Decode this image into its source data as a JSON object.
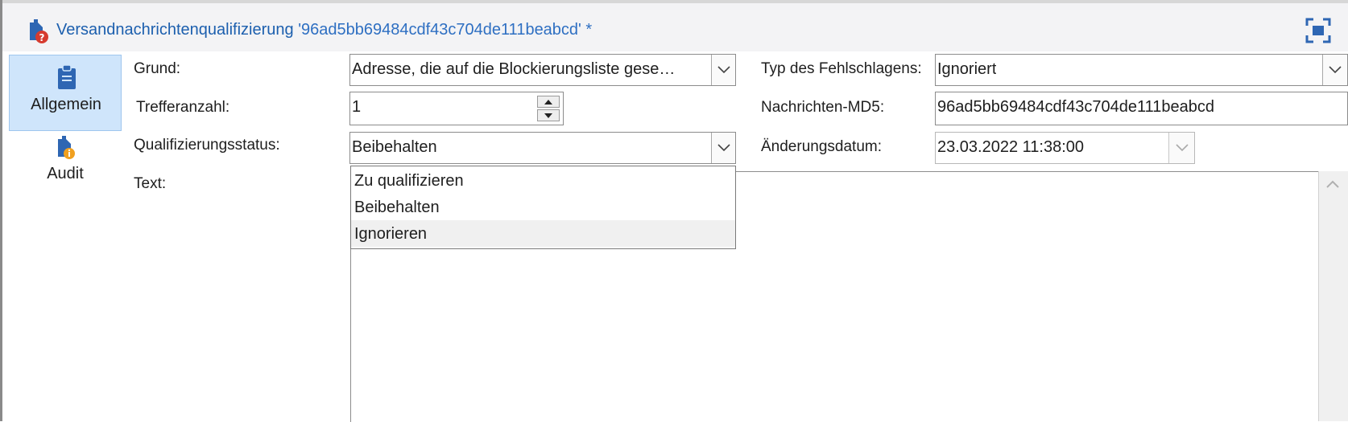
{
  "window": {
    "title_prefix": "Versandnachrichtenqualifizierung ",
    "title_id": "'96ad5bb69484cdf43c704de111beabcd' *",
    "maximize_icon": "maximize-icon"
  },
  "tabs": [
    {
      "label": "Allgemein",
      "icon": "clipboard-icon",
      "active": true
    },
    {
      "label": "Audit",
      "icon": "audit-info-icon",
      "active": false
    }
  ],
  "form": {
    "grund": {
      "label": "Grund:",
      "value": "Adresse, die auf die Blockierungsliste gese…"
    },
    "trefferanzahl": {
      "label": "Trefferanzahl:",
      "value": "1"
    },
    "qualifizierungsstatus": {
      "label": "Qualifizierungsstatus:",
      "value": "Beibehalten"
    },
    "text": {
      "label": "Text:"
    },
    "typ": {
      "label": "Typ des Fehlschlagens:",
      "value": "Ignoriert"
    },
    "md5": {
      "label": "Nachrichten-MD5:",
      "value": "96ad5bb69484cdf43c704de111beabcd"
    },
    "datum": {
      "label": "Änderungsdatum:",
      "value": "23.03.2022 11:38:00"
    }
  },
  "status_dropdown": {
    "options": [
      "Zu qualifizieren",
      "Beibehalten",
      "Ignorieren"
    ],
    "highlighted": "Ignorieren"
  },
  "colors": {
    "accent": "#1c5fae",
    "tab_active": "#cfe5fb",
    "warning_badge": "#d63b2f",
    "info_badge": "#f0a020"
  }
}
